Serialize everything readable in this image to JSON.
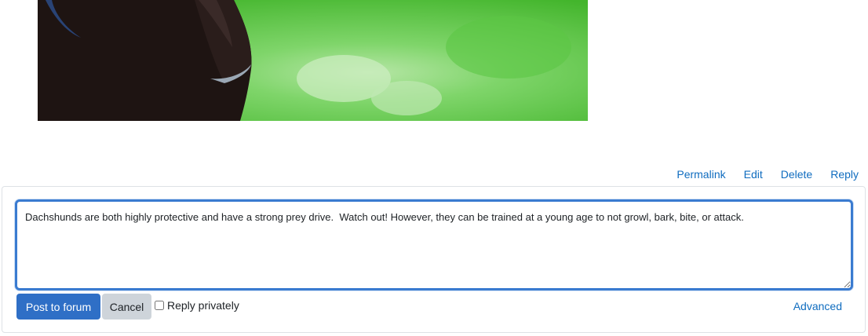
{
  "post": {
    "image": {
      "description_icon": "dog-photo"
    },
    "actions": {
      "permalink": "Permalink",
      "edit": "Edit",
      "delete": "Delete",
      "reply": "Reply"
    }
  },
  "reply_form": {
    "message": "Dachshunds are both highly protective and have a strong prey drive.  Watch out! However, they can be trained at a young age to not growl, bark, bite, or attack.",
    "post_button": "Post to forum",
    "cancel_button": "Cancel",
    "private_label": "Reply privately",
    "private_checked": false,
    "advanced_link": "Advanced"
  },
  "colors": {
    "accent": "#0f6cbf",
    "primary_button": "#2f6fc6",
    "secondary_button": "#ced4da",
    "focus_border": "#3a7bd0"
  }
}
